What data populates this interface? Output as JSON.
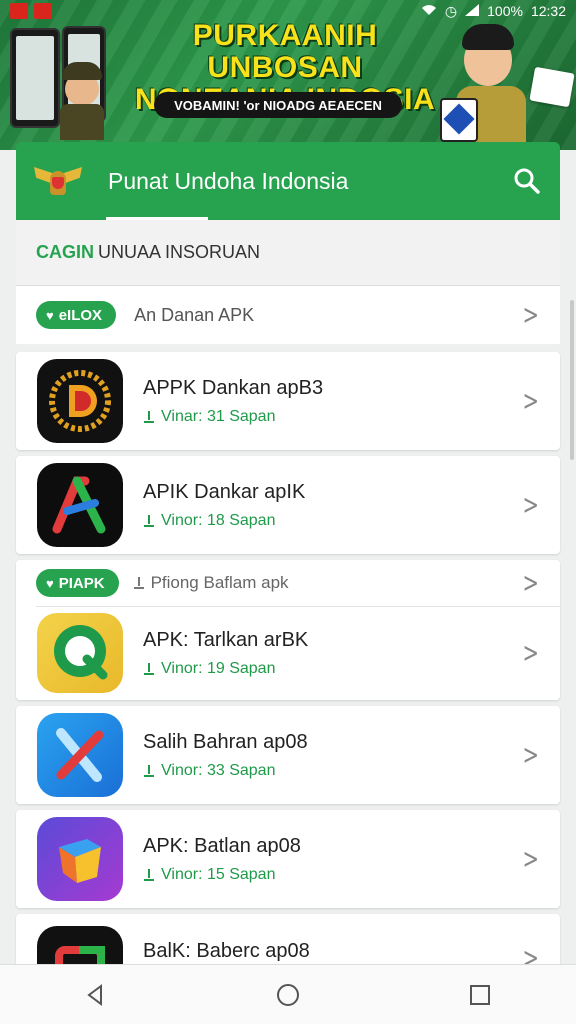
{
  "status_bar": {
    "battery": "100%",
    "time": "12:32"
  },
  "banner": {
    "title_line1": "PURKAANIH UNBOSAN",
    "title_line2": "NONEANIA INDOSIA",
    "subtitle": "VOBAMIN! 'or NIOADG AEAECEN"
  },
  "app_bar": {
    "title": "Punat Undoha Indonsia"
  },
  "section": {
    "prefix": "CAGIN",
    "label": "UNUAA INSORUAN"
  },
  "featured": {
    "pill_label": "eILOX",
    "text": "An Danan APK"
  },
  "apps": [
    {
      "name": "APPK Dankan apB3",
      "meta": "Vinar: 31 Sapan",
      "icon": "dark-circle-d-icon"
    },
    {
      "name": "APIK Dankar apIK",
      "meta": "Vinor: 18 Sapan",
      "icon": "colorful-a-icon"
    }
  ],
  "divider": {
    "pill_label": "PIAPK",
    "sub": "Pfiong Baflam apk"
  },
  "apps2": [
    {
      "name": "APK: Tarlkan arBK",
      "meta": "Vinor: 19 Sapan",
      "icon": "green-magnifier-icon"
    },
    {
      "name": "Salih Bahran ap08",
      "meta": "Vinor: 33 Sapan",
      "icon": "blue-slash-icon"
    },
    {
      "name": "APK: Batlan ap08",
      "meta": "Vinor: 15 Sapan",
      "icon": "cube-gradient-icon"
    },
    {
      "name": "BalK: Baberc ap08",
      "meta": "",
      "icon": "rainbow-square-icon"
    }
  ],
  "colors": {
    "primary": "#27a350",
    "accent_yellow": "#f7e21c"
  }
}
